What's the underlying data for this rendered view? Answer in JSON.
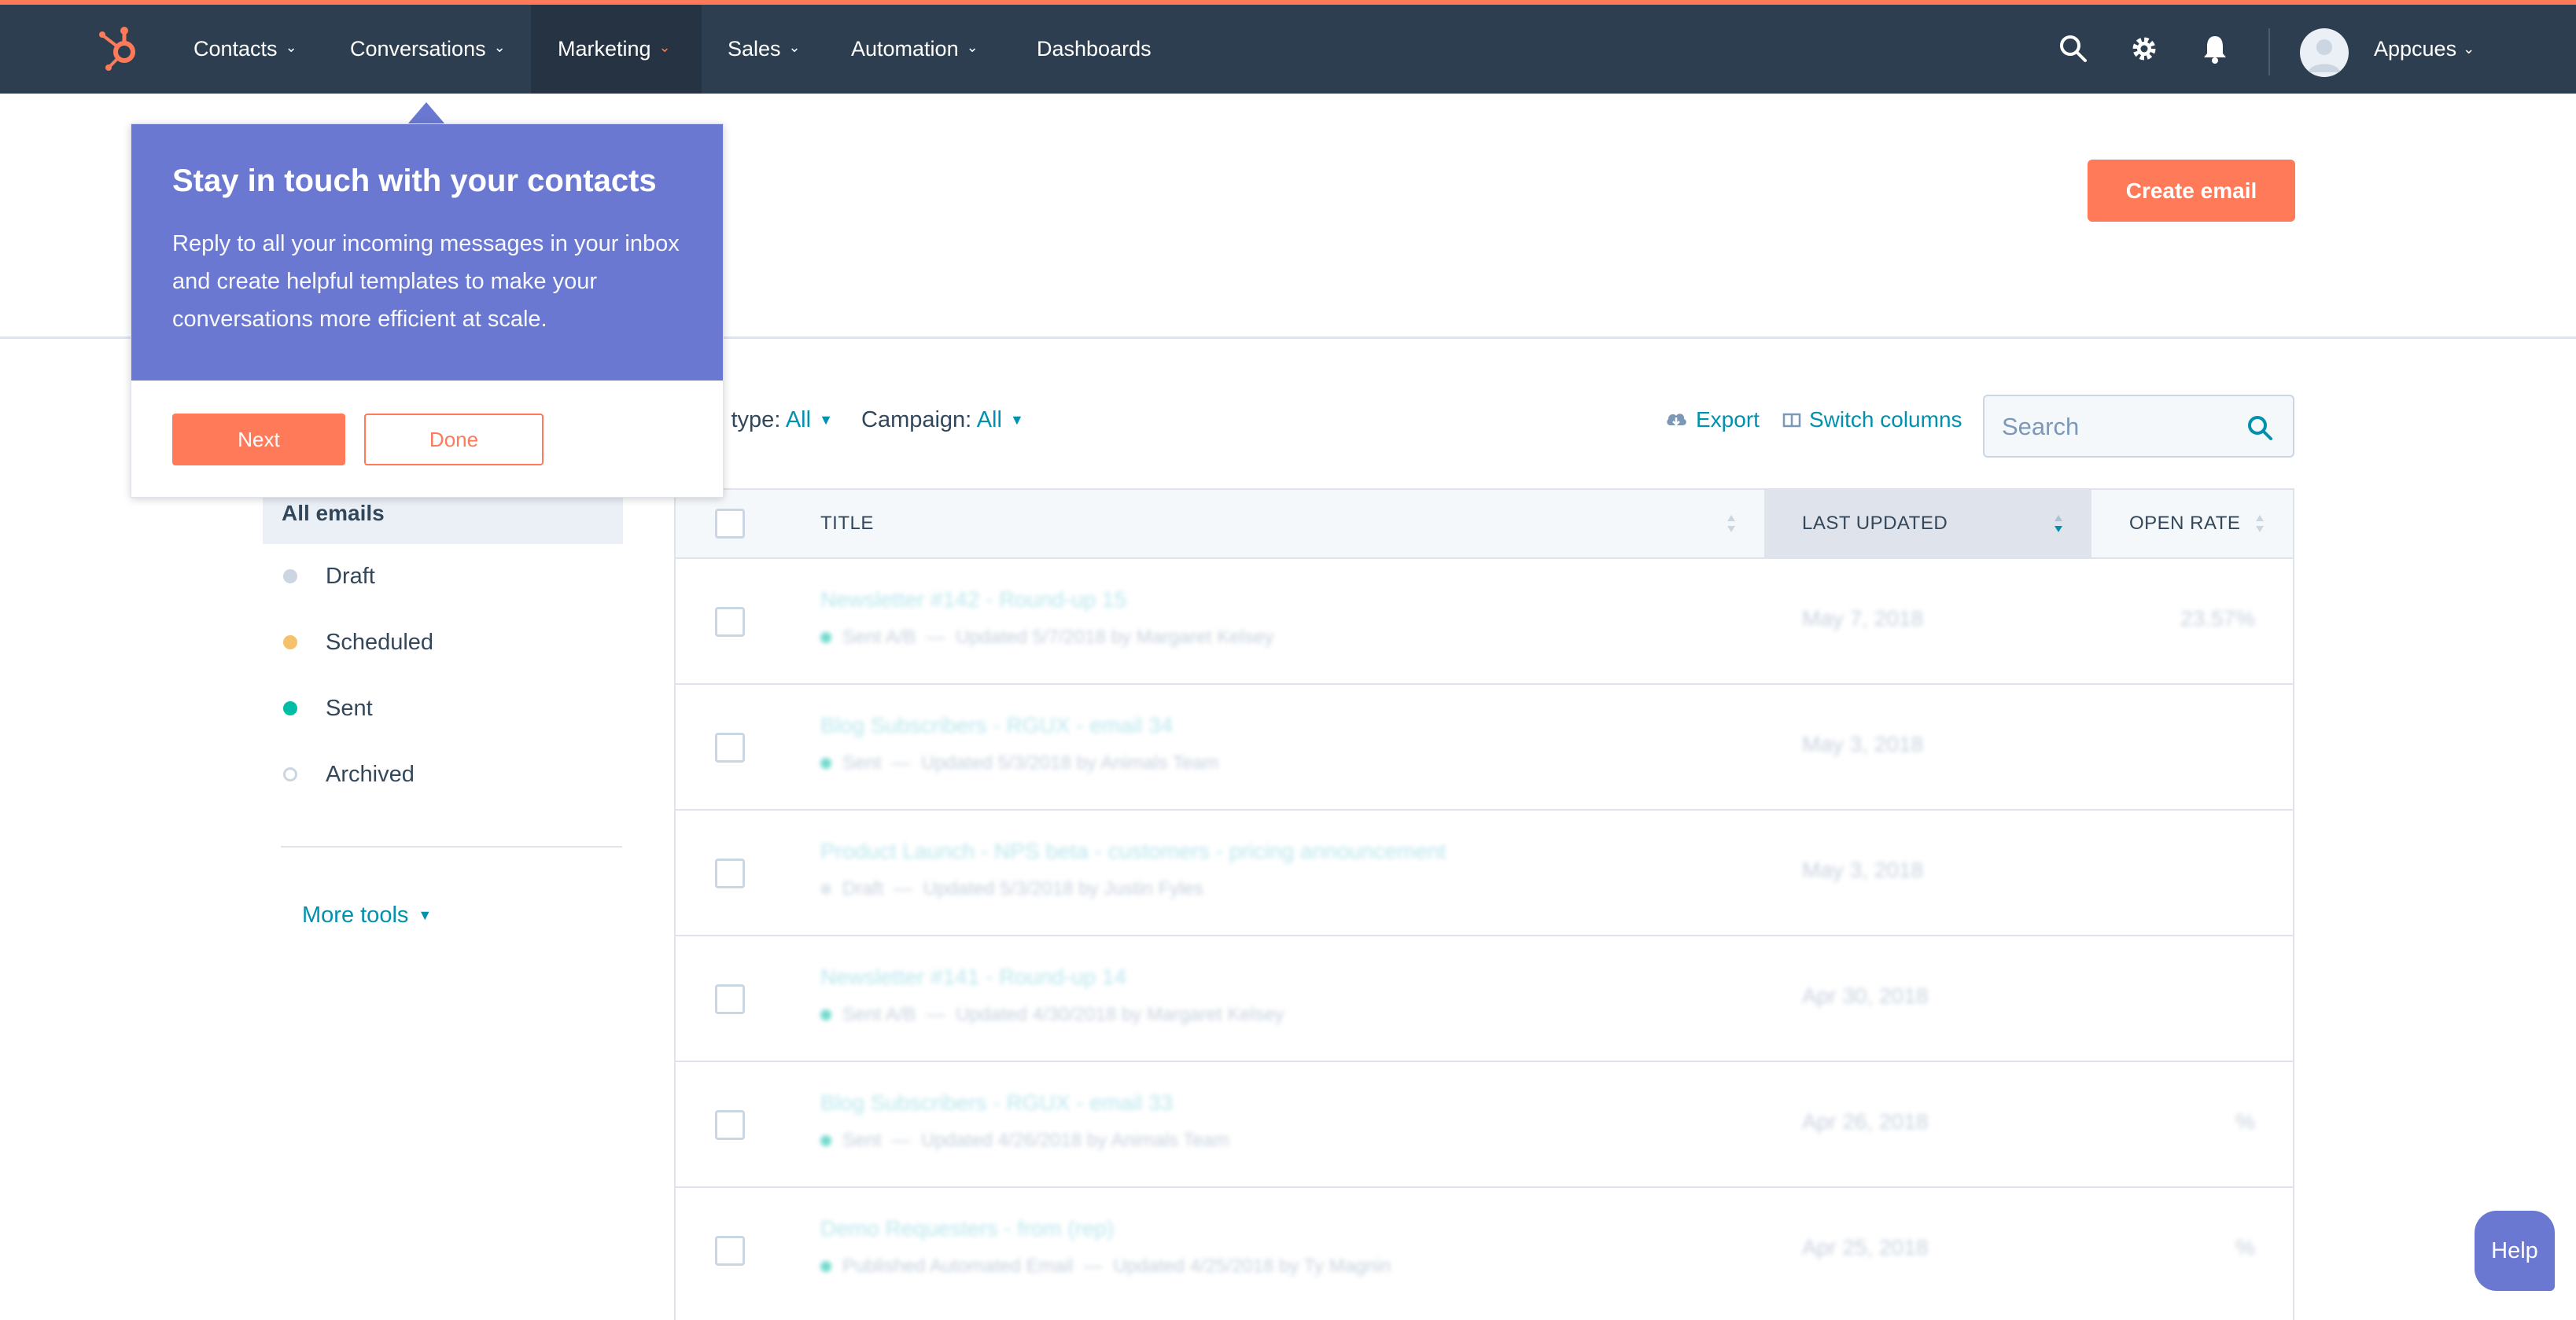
{
  "nav": {
    "items": [
      {
        "label": "Contacts",
        "chevron": true
      },
      {
        "label": "Conversations",
        "chevron": true
      },
      {
        "label": "Marketing",
        "chevron": true,
        "active": true
      },
      {
        "label": "Sales",
        "chevron": true
      },
      {
        "label": "Automation",
        "chevron": true
      },
      {
        "label": "Dashboards",
        "chevron": false
      }
    ],
    "account_name": "Appcues",
    "icons": [
      "hubspot-logo",
      "search-icon",
      "gear-icon",
      "bell-icon",
      "avatar"
    ],
    "colors": {
      "bar": "#2d3e50",
      "accent": "#ff7a59"
    }
  },
  "header": {
    "create_button": "Create email"
  },
  "filters": {
    "email_type_label": "l type:",
    "email_type_value": "All",
    "campaign_label": "Campaign:",
    "campaign_value": "All"
  },
  "actions": {
    "export": "Export",
    "switch_columns": "Switch columns",
    "search_placeholder": "Search"
  },
  "sidebar": {
    "active": "All emails",
    "items": [
      {
        "label": "Draft",
        "dot_color": "#cbd6e2"
      },
      {
        "label": "Scheduled",
        "dot_color": "#f5c26b"
      },
      {
        "label": "Sent",
        "dot_color": "#00bda5"
      },
      {
        "label": "Archived",
        "dot_color": "hollow"
      }
    ],
    "more_tools": "More tools"
  },
  "table": {
    "columns": [
      "TITLE",
      "LAST UPDATED",
      "OPEN RATE"
    ],
    "sorted_column": "LAST UPDATED",
    "rows": [
      {
        "title": "Newsletter #142 - Round-up 15",
        "status": "Sent A/B",
        "updated": "Updated 5/7/2018 by Margaret Kelsey",
        "date": "May 7, 2018",
        "open_rate": "23.57%"
      },
      {
        "title": "Blog Subscribers - RGUX - email 34",
        "status": "Sent",
        "updated": "Updated 5/3/2018 by Animals Team",
        "date": "May 3, 2018",
        "open_rate": ""
      },
      {
        "title": "Product Launch - NPS beta - customers - pricing announcement",
        "status": "Draft",
        "updated": "Updated 5/3/2018 by Justin Fyles",
        "date": "May 3, 2018",
        "open_rate": ""
      },
      {
        "title": "Newsletter #141 - Round-up 14",
        "status": "Sent A/B",
        "updated": "Updated 4/30/2018 by Margaret Kelsey",
        "date": "Apr 30, 2018",
        "open_rate": ""
      },
      {
        "title": "Blog Subscribers - RGUX - email 33",
        "status": "Sent",
        "updated": "Updated 4/26/2018 by Animals Team",
        "date": "Apr 26, 2018",
        "open_rate": "%"
      },
      {
        "title": "Demo Requesters - from (rep)",
        "status": "Published Automated Email",
        "updated": "Updated 4/25/2018 by Ty Magnin",
        "date": "Apr 25, 2018",
        "open_rate": "%"
      }
    ]
  },
  "tour": {
    "title": "Stay in touch with your contacts",
    "body": "Reply to all your incoming messages in your inbox and create helpful templates to make your conversations more efficient at scale.",
    "next": "Next",
    "done": "Done",
    "color": "#6a78d1"
  },
  "help": {
    "label": "Help"
  }
}
